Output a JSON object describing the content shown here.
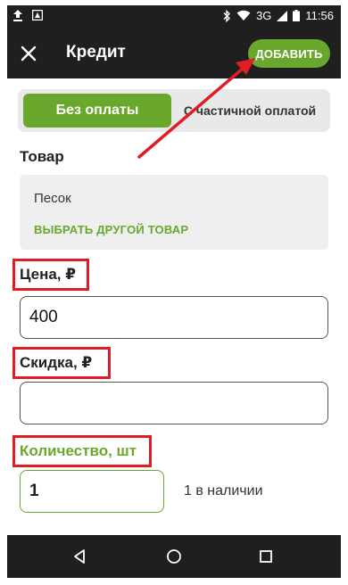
{
  "status_bar": {
    "network": "3G",
    "time": "11:56"
  },
  "app_bar": {
    "title": "Кредит",
    "add_label": "ДОБАВИТЬ"
  },
  "payment_toggle": {
    "options": [
      {
        "label": "Без оплаты",
        "active": true
      },
      {
        "label": "С частичной оплатой",
        "active": false
      }
    ]
  },
  "product": {
    "section_label": "Товар",
    "name": "Песок",
    "change_label": "ВЫБРАТЬ ДРУГОЙ ТОВАР"
  },
  "price": {
    "label": "Цена, ₽",
    "value": "400"
  },
  "discount": {
    "label": "Скидка, ₽",
    "value": ""
  },
  "quantity": {
    "label": "Количество, шт",
    "value": "1",
    "stock_text": "1 в наличии"
  },
  "colors": {
    "accent": "#6aa72d",
    "annotation": "#e01c24",
    "bar": "#1f1f1f"
  },
  "icons": [
    "upload-icon",
    "notification-icon",
    "bluetooth-icon",
    "wifi-icon",
    "signal-icon",
    "battery-icon",
    "close-icon",
    "back-icon",
    "home-icon",
    "recents-icon"
  ]
}
